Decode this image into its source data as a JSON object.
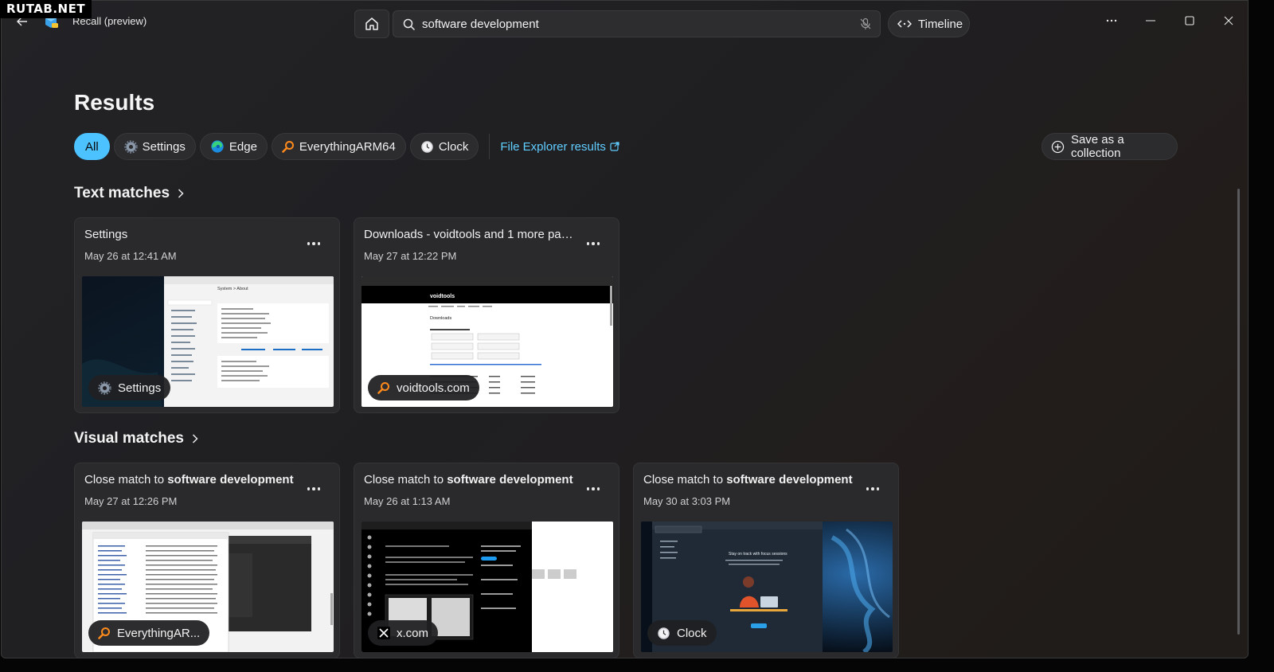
{
  "watermark": "RUTAB.NET",
  "app": {
    "title": "Recall (preview)"
  },
  "search": {
    "value": "software development",
    "placeholder": ""
  },
  "timeline_label": "Timeline",
  "results_title": "Results",
  "filters": [
    {
      "label": "All",
      "icon": ""
    },
    {
      "label": "Settings",
      "icon": "settings-gear-icon"
    },
    {
      "label": "Edge",
      "icon": "edge-browser-icon"
    },
    {
      "label": "EverythingARM64",
      "icon": "everything-search-icon"
    },
    {
      "label": "Clock",
      "icon": "clock-icon"
    }
  ],
  "file_explorer_link": "File Explorer results",
  "save_collection_label": "Save as a collection",
  "text_matches": {
    "title": "Text matches",
    "cards": [
      {
        "title": "Settings",
        "date": "May 26 at 12:41 AM",
        "badge": "Settings"
      },
      {
        "title": "Downloads - voidtools and 1 more page...",
        "date": "May 27 at 12:22 PM",
        "badge": "voidtools.com"
      }
    ]
  },
  "visual_matches": {
    "title": "Visual matches",
    "cards": [
      {
        "prefix": "Close match to ",
        "term": "software development",
        "date": "May 27 at 12:26 PM",
        "badge": "EverythingAR..."
      },
      {
        "prefix": "Close match to ",
        "term": "software development",
        "date": "May 26 at 1:13 AM",
        "badge": "x.com"
      },
      {
        "prefix": "Close match to ",
        "term": "software development",
        "date": "May 30 at 3:03 PM",
        "badge": "Clock"
      }
    ]
  },
  "thumb_texts": {
    "settings_header": "System > About",
    "voidtools_site": "voidtools",
    "voidtools_heading": "Downloads",
    "clock_promo": "Stay on track with focus sessions"
  },
  "colors": {
    "accent": "#4cc2ff",
    "link": "#60cdff",
    "background": "#202023",
    "card": "#2a2a2d"
  }
}
